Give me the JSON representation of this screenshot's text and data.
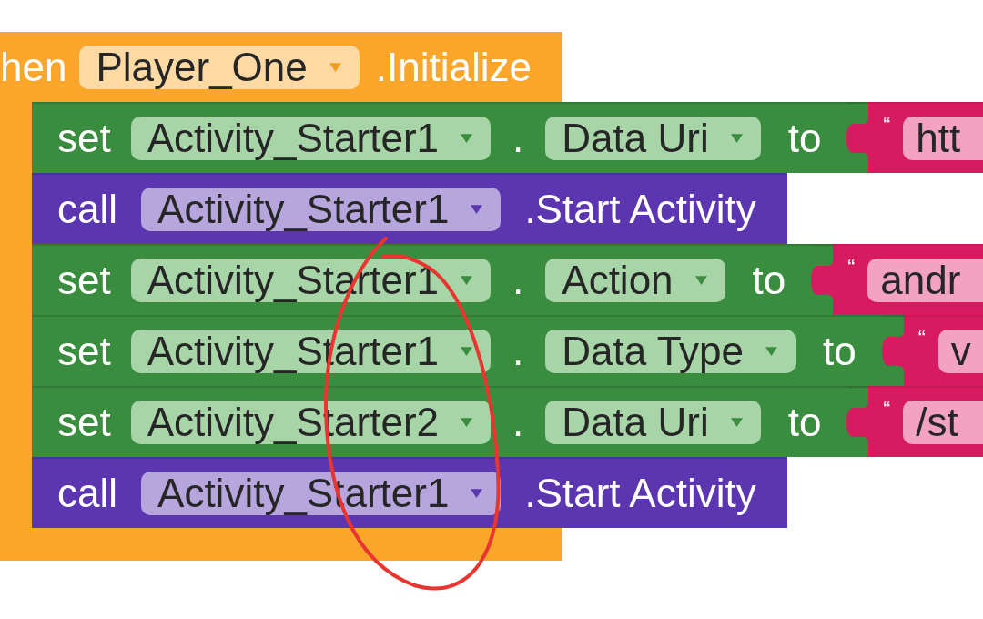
{
  "event_block": {
    "keyword": "hen",
    "component": "Player_One",
    "event": ".Initialize",
    "statements": [
      {
        "kind": "setter",
        "keyword": "set",
        "component": "Activity_Starter1",
        "separator": ".",
        "property": "Data Uri",
        "connector": "to",
        "value": {
          "quote": "“",
          "text": "htt"
        }
      },
      {
        "kind": "method",
        "keyword": "call",
        "component": "Activity_Starter1",
        "method": ".Start Activity"
      },
      {
        "kind": "setter",
        "keyword": "set",
        "component": "Activity_Starter1",
        "separator": ".",
        "property": "Action",
        "connector": "to",
        "value": {
          "quote": "“",
          "text": "andr"
        }
      },
      {
        "kind": "setter",
        "keyword": "set",
        "component": "Activity_Starter1",
        "separator": ".",
        "property": "Data Type",
        "connector": "to",
        "value": {
          "quote": "“",
          "text": "v"
        }
      },
      {
        "kind": "setter",
        "keyword": "set",
        "component": "Activity_Starter2",
        "separator": ".",
        "property": "Data Uri",
        "connector": "to",
        "value": {
          "quote": "“",
          "text": "/st"
        }
      },
      {
        "kind": "method",
        "keyword": "call",
        "component": "Activity_Starter1",
        "method": ".Start Activity"
      }
    ]
  }
}
